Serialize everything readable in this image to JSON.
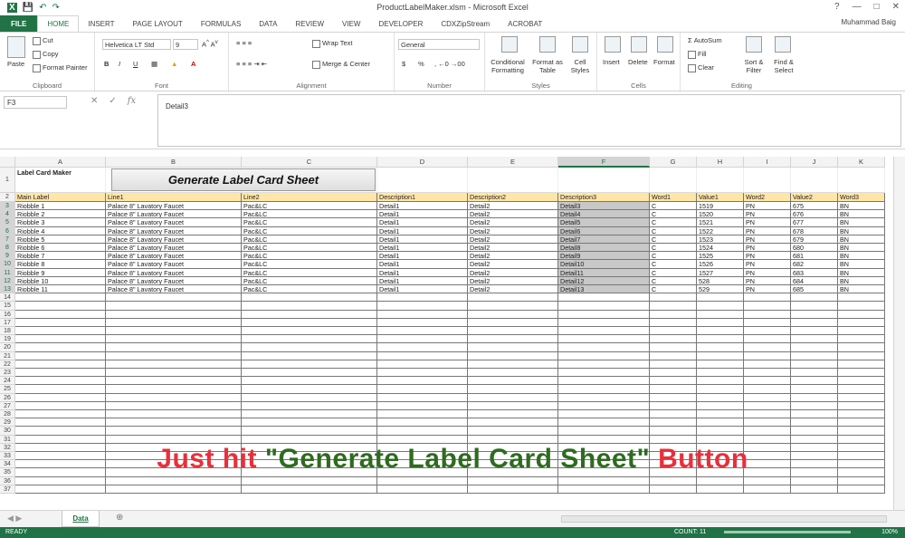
{
  "window": {
    "title": "ProductLabelMaker.xlsm - Microsoft Excel",
    "user": "Muhammad Baig"
  },
  "tabs": [
    "FILE",
    "HOME",
    "INSERT",
    "PAGE LAYOUT",
    "FORMULAS",
    "DATA",
    "REVIEW",
    "VIEW",
    "DEVELOPER",
    "CDXZipStream",
    "ACROBAT"
  ],
  "active_tab": "HOME",
  "ribbon": {
    "clipboard": {
      "label": "Clipboard",
      "paste": "Paste",
      "cut": "Cut",
      "copy": "Copy",
      "format_painter": "Format Painter"
    },
    "font": {
      "label": "Font",
      "name": "Helvetica LT Std",
      "size": "9",
      "bold": "B",
      "italic": "I",
      "underline": "U"
    },
    "alignment": {
      "label": "Alignment",
      "wrap": "Wrap Text",
      "merge": "Merge & Center"
    },
    "number": {
      "label": "Number",
      "format": "General",
      "currency": "$",
      "percent": "%"
    },
    "styles": {
      "label": "Styles",
      "conditional": "Conditional Formatting",
      "format_table": "Format as Table",
      "cell_styles": "Cell Styles"
    },
    "cells": {
      "label": "Cells",
      "insert": "Insert",
      "delete": "Delete",
      "format": "Format"
    },
    "editing": {
      "label": "Editing",
      "autosum": "AutoSum",
      "fill": "Fill",
      "clear": "Clear",
      "sort": "Sort & Filter",
      "find": "Find & Select"
    }
  },
  "formula_bar": {
    "name_box": "F3",
    "value": "Detail3",
    "fx": "fx"
  },
  "columns": [
    {
      "name": "A"
    },
    {
      "name": "B"
    },
    {
      "name": "C"
    },
    {
      "name": "D"
    },
    {
      "name": "E"
    },
    {
      "name": "F"
    },
    {
      "name": "G"
    },
    {
      "name": "H"
    },
    {
      "name": "I"
    },
    {
      "name": "J"
    },
    {
      "name": "K"
    }
  ],
  "selected_column": "F",
  "title_cell": "Label Card Maker",
  "generate_button": "Generate Label Card Sheet",
  "header_row": [
    "Main Label",
    "Line1",
    "Line2",
    "Description1",
    "Description2",
    "Description3",
    "Word1",
    "Value1",
    "Word2",
    "Value2",
    "Word3"
  ],
  "data_rows": [
    [
      "Riobble 1",
      "Palace 8\" Lavatory Faucet",
      "Pac&LC",
      "Detail1",
      "Detail2",
      "Detail3",
      "C",
      "1519",
      "PN",
      "675",
      "BN"
    ],
    [
      "Riobble 2",
      "Palace 8\" Lavatory Faucet",
      "Pac&LC",
      "Detail1",
      "Detail2",
      "Detail4",
      "C",
      "1520",
      "PN",
      "676",
      "BN"
    ],
    [
      "Riobble 3",
      "Palace 8\" Lavatory Faucet",
      "Pac&LC",
      "Detail1",
      "Detail2",
      "Detail5",
      "C",
      "1521",
      "PN",
      "677",
      "BN"
    ],
    [
      "Riobble 4",
      "Palace 8\" Lavatory Faucet",
      "Pac&LC",
      "Detail1",
      "Detail2",
      "Detail6",
      "C",
      "1522",
      "PN",
      "678",
      "BN"
    ],
    [
      "Riobble 5",
      "Palace 8\" Lavatory Faucet",
      "Pac&LC",
      "Detail1",
      "Detail2",
      "Detail7",
      "C",
      "1523",
      "PN",
      "679",
      "BN"
    ],
    [
      "Riobble 6",
      "Palace 8\" Lavatory Faucet",
      "Pac&LC",
      "Detail1",
      "Detail2",
      "Detail8",
      "C",
      "1524",
      "PN",
      "680",
      "BN"
    ],
    [
      "Riobble 7",
      "Palace 8\" Lavatory Faucet",
      "Pac&LC",
      "Detail1",
      "Detail2",
      "Detail9",
      "C",
      "1525",
      "PN",
      "681",
      "BN"
    ],
    [
      "Riobble 8",
      "Palace 8\" Lavatory Faucet",
      "Pac&LC",
      "Detail1",
      "Detail2",
      "Detail10",
      "C",
      "1526",
      "PN",
      "682",
      "BN"
    ],
    [
      "Riobble 9",
      "Palace 8\" Lavatory Faucet",
      "Pac&LC",
      "Detail1",
      "Detail2",
      "Detail11",
      "C",
      "1527",
      "PN",
      "683",
      "BN"
    ],
    [
      "Riobble 10",
      "Palace 8\" Lavatory Faucet",
      "Pac&LC",
      "Detail1",
      "Detail2",
      "Detail12",
      "C",
      "528",
      "PN",
      "684",
      "BN"
    ],
    [
      "Riobble 11",
      "Palace 8\" Lavatory Faucet",
      "Pac&LC",
      "Detail1",
      "Detail2",
      "Detail13",
      "C",
      "529",
      "PN",
      "685",
      "BN"
    ]
  ],
  "overlay": {
    "part1": "Just hit ",
    "part2": "\"Generate Label Card Sheet\"",
    "part3": " Button",
    "color_red": "#e8303a",
    "color_green": "#2e6b1f"
  },
  "sheet_tab": "Data",
  "status": {
    "ready": "READY",
    "count": "COUNT: 11",
    "zoom": "100%"
  },
  "accent": "#217346"
}
